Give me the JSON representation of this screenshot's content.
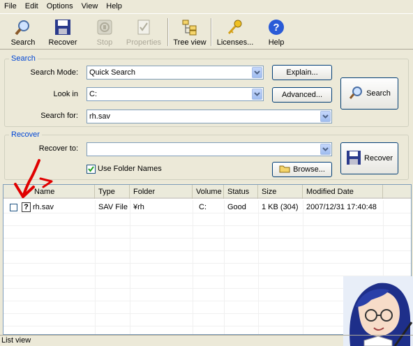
{
  "menu": [
    "File",
    "Edit",
    "Options",
    "View",
    "Help"
  ],
  "toolbar": {
    "search": "Search",
    "recover": "Recover",
    "stop": "Stop",
    "properties": "Properties",
    "tree_view": "Tree view",
    "licenses": "Licenses...",
    "help": "Help"
  },
  "search_group": {
    "title": "Search",
    "mode_label": "Search Mode:",
    "mode_value": "Quick Search",
    "lookin_label": "Look in",
    "lookin_value": "C:",
    "searchfor_label": "Search for:",
    "searchfor_value": "rh.sav",
    "explain_button": "Explain...",
    "advanced_button": "Advanced...",
    "search_button": "Search"
  },
  "recover_group": {
    "title": "Recover",
    "recover_to_label": "Recover to:",
    "recover_to_value": "",
    "use_folder_names": "Use Folder Names",
    "use_folder_names_checked": true,
    "browse_button": "Browse...",
    "recover_button": "Recover"
  },
  "list": {
    "columns": [
      "Name",
      "Type",
      "Folder",
      "Volume",
      "Status",
      "Size",
      "Modified Date"
    ],
    "rows": [
      {
        "name": "rh.sav",
        "type": "SAV File",
        "folder": "¥rh",
        "volume": "C:",
        "status": "Good",
        "size": "1 KB (304)",
        "modified": "2007/12/31 17:40:48"
      }
    ]
  },
  "status_bar": "List view",
  "colors": {
    "accent": "#0046d5",
    "annotation": "#e00000",
    "face": "#ece9d8"
  }
}
